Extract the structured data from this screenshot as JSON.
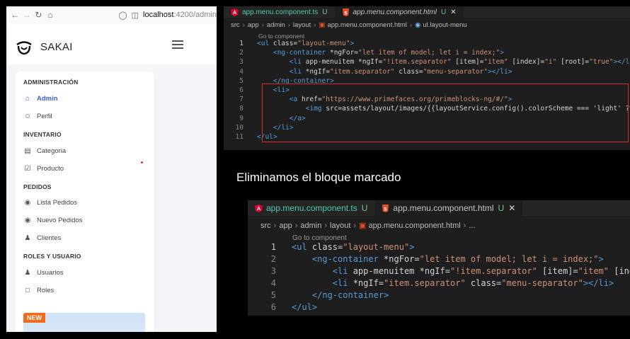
{
  "browser": {
    "url_host": "localhost",
    "url_path": ":4200/admin"
  },
  "app": {
    "name": "SAKAI"
  },
  "sidebar": {
    "sections": [
      {
        "title": "ADMINISTRACIÓN",
        "items": [
          {
            "label": "Admin",
            "icon": "home-icon",
            "active": true
          },
          {
            "label": "Perfil",
            "icon": "user-icon"
          }
        ]
      },
      {
        "title": "INVENTARIO",
        "items": [
          {
            "label": "Categoria",
            "icon": "id-card-icon"
          },
          {
            "label": "Producto",
            "icon": "check-square-icon"
          }
        ]
      },
      {
        "title": "PEDIDOS",
        "items": [
          {
            "label": "Lista Pedidos",
            "icon": "eye-icon"
          },
          {
            "label": "Nuevo Pedidos",
            "icon": "eye-icon"
          },
          {
            "label": "Clientes",
            "icon": "users-icon"
          }
        ]
      },
      {
        "title": "ROLES Y USUARIO",
        "items": [
          {
            "label": "Usuarios",
            "icon": "users-icon"
          },
          {
            "label": "Roles",
            "icon": "desktop-icon"
          }
        ]
      }
    ],
    "promo_badge": "NEW"
  },
  "editor1": {
    "tabs": [
      {
        "name": "app.menu.component.ts",
        "status": "U",
        "icon": "angular-icon"
      },
      {
        "name": "app.menu.component.html",
        "status": "U",
        "icon": "html5-icon",
        "active": true
      }
    ],
    "breadcrumb": [
      "src",
      "app",
      "admin",
      "layout",
      "app.menu.component.html",
      "ul.layout-menu"
    ],
    "codelens": "Go to component",
    "lines": [
      {
        "n": "1",
        "code": "<ul class=\"layout-menu\">"
      },
      {
        "n": "2",
        "code": "    <ng-container *ngFor=\"let item of model; let i = index;\">"
      },
      {
        "n": "3",
        "code": "        <li app-menuitem *ngIf=\"!item.separator\" [item]=\"item\" [index]=\"i\" [root]=\"true\"></li>"
      },
      {
        "n": "4",
        "code": "        <li *ngIf=\"item.separator\" class=\"menu-separator\"></li>"
      },
      {
        "n": "5",
        "code": "    </ng-container>"
      },
      {
        "n": "6",
        "code": "    <li>"
      },
      {
        "n": "7",
        "code": "        <a href=\"https://www.primefaces.org/primeblocks-ng/#/\">"
      },
      {
        "n": "8",
        "code": "            <img src=\"assets/layout/images/{{layoutService.config().colorScheme === 'light' ?"
      },
      {
        "n": "9",
        "code": "        </a>"
      },
      {
        "n": "10",
        "code": "    </li>"
      },
      {
        "n": "11",
        "code": "</ul>"
      }
    ]
  },
  "caption": "Eliminamos el bloque marcado",
  "editor2": {
    "tabs": [
      {
        "name": "app.menu.component.ts",
        "status": "U",
        "icon": "angular-icon"
      },
      {
        "name": "app.menu.component.html",
        "status": "U",
        "icon": "html5-icon",
        "active": true
      }
    ],
    "breadcrumb": [
      "src",
      "app",
      "admin",
      "layout",
      "app.menu.component.html",
      "..."
    ],
    "codelens": "Go to component",
    "lines": [
      {
        "n": "1",
        "code": "<ul class=\"layout-menu\">"
      },
      {
        "n": "2",
        "code": "    <ng-container *ngFor=\"let item of model; let i = index;\">"
      },
      {
        "n": "3",
        "code": "        <li app-menuitem *ngIf=\"!item.separator\" [item]=\"item\" [index]"
      },
      {
        "n": "4",
        "code": "        <li *ngIf=\"item.separator\" class=\"menu-separator\"></li>"
      },
      {
        "n": "5",
        "code": "    </ng-container>"
      },
      {
        "n": "6",
        "code": "</ul>"
      }
    ]
  },
  "colors": {
    "accent": "#3b5fd9",
    "highlight_border": "#d32f2f",
    "badge": "#f26b1d"
  }
}
